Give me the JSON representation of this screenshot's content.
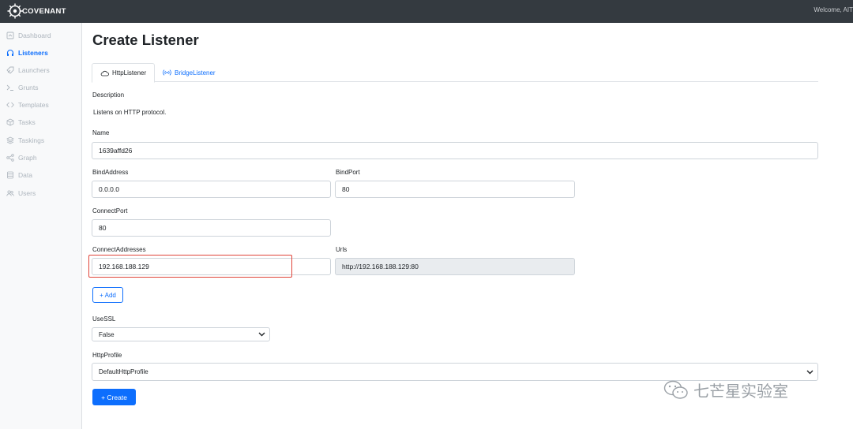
{
  "header": {
    "brand": "COVENANT",
    "welcome": "Welcome, AIT"
  },
  "sidebar": {
    "items": [
      {
        "label": "Dashboard",
        "icon": "home-icon"
      },
      {
        "label": "Listeners",
        "icon": "headphones-icon",
        "active": true
      },
      {
        "label": "Launchers",
        "icon": "rocket-icon"
      },
      {
        "label": "Grunts",
        "icon": "terminal-icon"
      },
      {
        "label": "Templates",
        "icon": "code-icon"
      },
      {
        "label": "Tasks",
        "icon": "box-icon"
      },
      {
        "label": "Taskings",
        "icon": "layers-icon"
      },
      {
        "label": "Graph",
        "icon": "share-icon"
      },
      {
        "label": "Data",
        "icon": "database-icon"
      },
      {
        "label": "Users",
        "icon": "users-icon"
      }
    ]
  },
  "page": {
    "title": "Create Listener",
    "tabs": [
      {
        "label": "HttpListener",
        "icon": "cloud-icon",
        "active": true
      },
      {
        "label": "BridgeListener",
        "icon": "broadcast-icon"
      }
    ]
  },
  "form": {
    "description_label": "Description",
    "description_text": "Listens on HTTP protocol.",
    "name_label": "Name",
    "name_value": "1639affd26",
    "bindaddress_label": "BindAddress",
    "bindaddress_value": "0.0.0.0",
    "bindport_label": "BindPort",
    "bindport_value": "80",
    "connectport_label": "ConnectPort",
    "connectport_value": "80",
    "connectaddresses_label": "ConnectAddresses",
    "connectaddresses_value": "192.168.188.129",
    "urls_label": "Urls",
    "urls_value": "http://192.168.188.129:80",
    "add_button": "+ Add",
    "usessl_label": "UseSSL",
    "usessl_value": "False",
    "httpprofile_label": "HttpProfile",
    "httpprofile_value": "DefaultHttpProfile",
    "create_button": "+ Create"
  },
  "watermark": {
    "text": "七芒星实验室"
  },
  "colors": {
    "topbar": "#343a40",
    "accent": "#0d6efd",
    "highlight": "#e0443a"
  }
}
